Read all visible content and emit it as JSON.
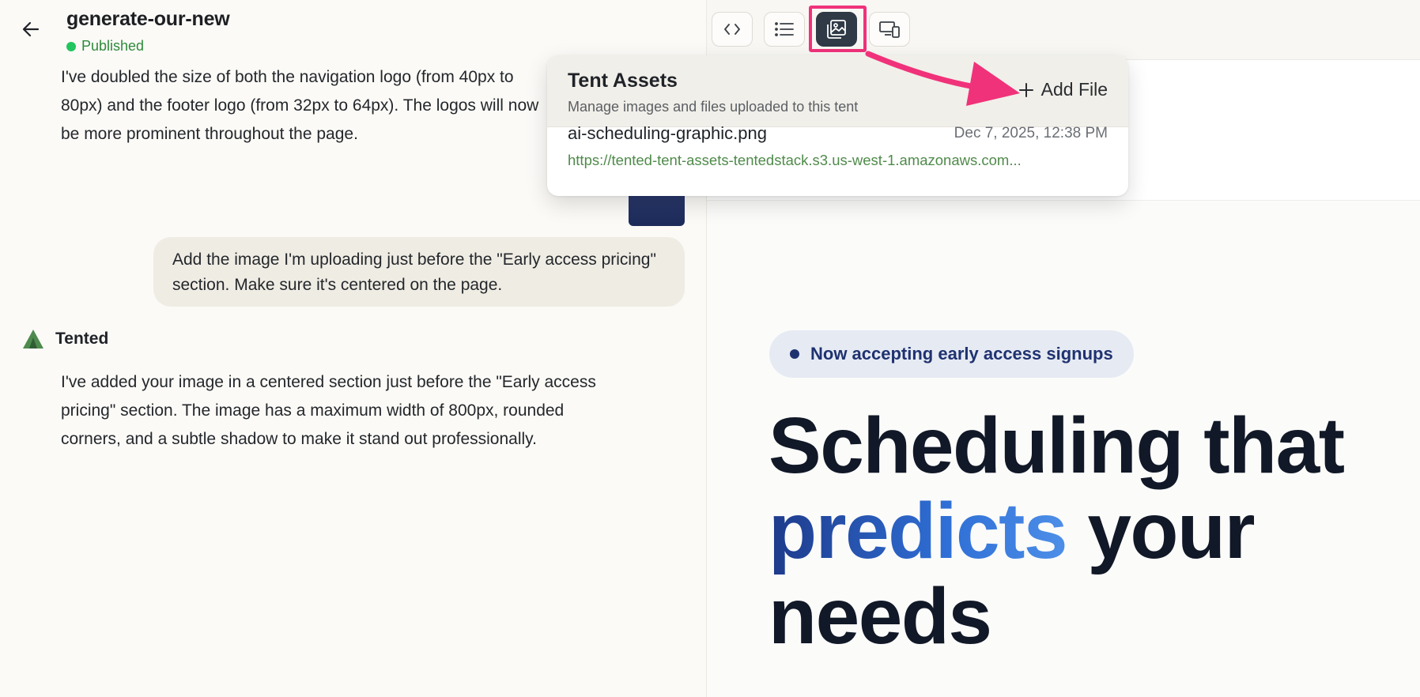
{
  "header": {
    "title": "generate-our-new",
    "status": "Published"
  },
  "chat": {
    "assistant_msg_1": "I've doubled the size of both the navigation logo (from 40px to 80px) and the footer logo (from 32px to 64px). The logos will now be more prominent throughout the page.",
    "user_msg": "Add the image I'm uploading just before the \"Early access pricing\" section. Make sure it's centered on the page.",
    "assistant_name": "Tented",
    "assistant_msg_2": "I've added your image in a centered section just before the \"Early access pricing\" section. The image has a maximum width of 800px, rounded corners, and a subtle shadow to make it stand out professionally."
  },
  "toolbar": {
    "code_icon": "code-icon",
    "list_icon": "list-icon",
    "assets_icon": "image-gallery-icon",
    "devices_icon": "devices-icon"
  },
  "assets_popover": {
    "title": "Tent Assets",
    "subtitle": "Manage images and files uploaded to this tent",
    "add_file_label": "Add File",
    "files": [
      {
        "name": "ai-scheduling-graphic.png",
        "date": "Dec 7, 2025, 12:38 PM",
        "url": "https://tented-tent-assets-tentedstack.s3.us-west-1.amazonaws.com..."
      }
    ]
  },
  "preview": {
    "badge": "Now accepting early access signups",
    "hero_line1": "Scheduling that",
    "hero_accent": "predicts",
    "hero_line2_rest": "your",
    "hero_line3": "needs"
  },
  "colors": {
    "published_green": "#22c55e",
    "highlight_pink": "#f0327a",
    "active_button": "#2f3a46",
    "hero_accent_start": "#1e3a8a",
    "hero_accent_end": "#4d8fe8",
    "badge_text": "#1f3270"
  }
}
